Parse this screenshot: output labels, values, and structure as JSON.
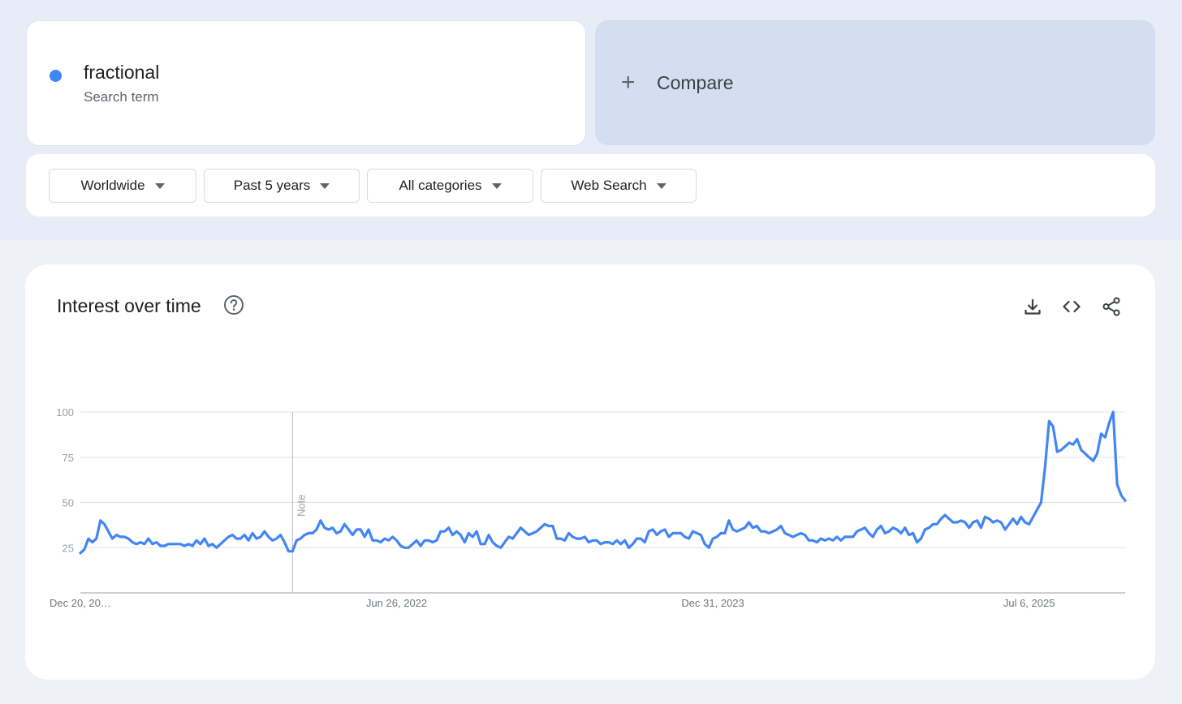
{
  "search_term": {
    "name": "fractional",
    "subtitle": "Search term",
    "color": "#4285f4"
  },
  "compare": {
    "label": "Compare",
    "icon": "plus-icon"
  },
  "filters": [
    {
      "label": "Worldwide"
    },
    {
      "label": "Past 5 years"
    },
    {
      "label": "All categories"
    },
    {
      "label": "Web Search"
    }
  ],
  "chart_card": {
    "title": "Interest over time",
    "tools": [
      "download-icon",
      "embed-code-icon",
      "share-icon"
    ]
  },
  "chart_data": {
    "type": "line",
    "title": "Interest over time",
    "xlabel": "",
    "ylabel": "",
    "ylim": [
      0,
      100
    ],
    "yticks": [
      25,
      50,
      75,
      100
    ],
    "xtick_labels": [
      "Dec 20, 20…",
      "Jun 26, 2022",
      "Dec 31, 2023",
      "Jul 6, 2025"
    ],
    "xtick_weeks": [
      0,
      79,
      158,
      237
    ],
    "annotation": {
      "label": "Note",
      "week": 53
    },
    "grid": true,
    "legend": "none",
    "series": [
      {
        "name": "fractional",
        "color": "#4285f4",
        "values": [
          22,
          24,
          30,
          28,
          30,
          40,
          38,
          34,
          30,
          32,
          31,
          31,
          30,
          28,
          27,
          28,
          27,
          30,
          27,
          28,
          26,
          26,
          27,
          27,
          27,
          27,
          26,
          27,
          26,
          29,
          27,
          30,
          26,
          27,
          25,
          27,
          29,
          31,
          32,
          30,
          30,
          32,
          29,
          33,
          30,
          31,
          34,
          31,
          29,
          30,
          32,
          28,
          23,
          23,
          29,
          30,
          32,
          33,
          33,
          35,
          40,
          36,
          35,
          36,
          33,
          34,
          38,
          35,
          32,
          35,
          35,
          31,
          35,
          29,
          29,
          28,
          30,
          29,
          31,
          29,
          26,
          25,
          25,
          27,
          29,
          26,
          29,
          29,
          28,
          29,
          34,
          34,
          36,
          32,
          34,
          32,
          28,
          33,
          31,
          34,
          27,
          27,
          32,
          28,
          26,
          25,
          28,
          31,
          30,
          33,
          36,
          34,
          32,
          33,
          34,
          36,
          38,
          37,
          37,
          30,
          30,
          29,
          33,
          31,
          30,
          30,
          31,
          28,
          29,
          29,
          27,
          28,
          28,
          27,
          29,
          27,
          29,
          25,
          27,
          30,
          30,
          28,
          34,
          35,
          32,
          34,
          35,
          31,
          33,
          33,
          33,
          31,
          30,
          34,
          33,
          32,
          27,
          25,
          30,
          31,
          33,
          33,
          40,
          35,
          34,
          35,
          36,
          39,
          36,
          37,
          34,
          34,
          33,
          34,
          35,
          37,
          33,
          32,
          31,
          32,
          33,
          32,
          29,
          29,
          28,
          30,
          29,
          30,
          29,
          31,
          29,
          31,
          31,
          31,
          34,
          35,
          36,
          33,
          31,
          35,
          37,
          33,
          34,
          36,
          35,
          33,
          36,
          32,
          33,
          28,
          30,
          35,
          36,
          38,
          38,
          41,
          43,
          41,
          39,
          39,
          40,
          39,
          36,
          39,
          40,
          36,
          42,
          41,
          39,
          40,
          39,
          35,
          38,
          41,
          38,
          42,
          39,
          38,
          42,
          46,
          50,
          70,
          95,
          92,
          78,
          79,
          81,
          83,
          82,
          85,
          79,
          77,
          75,
          73,
          77,
          88,
          86,
          94,
          100,
          60,
          54,
          51
        ]
      }
    ]
  }
}
